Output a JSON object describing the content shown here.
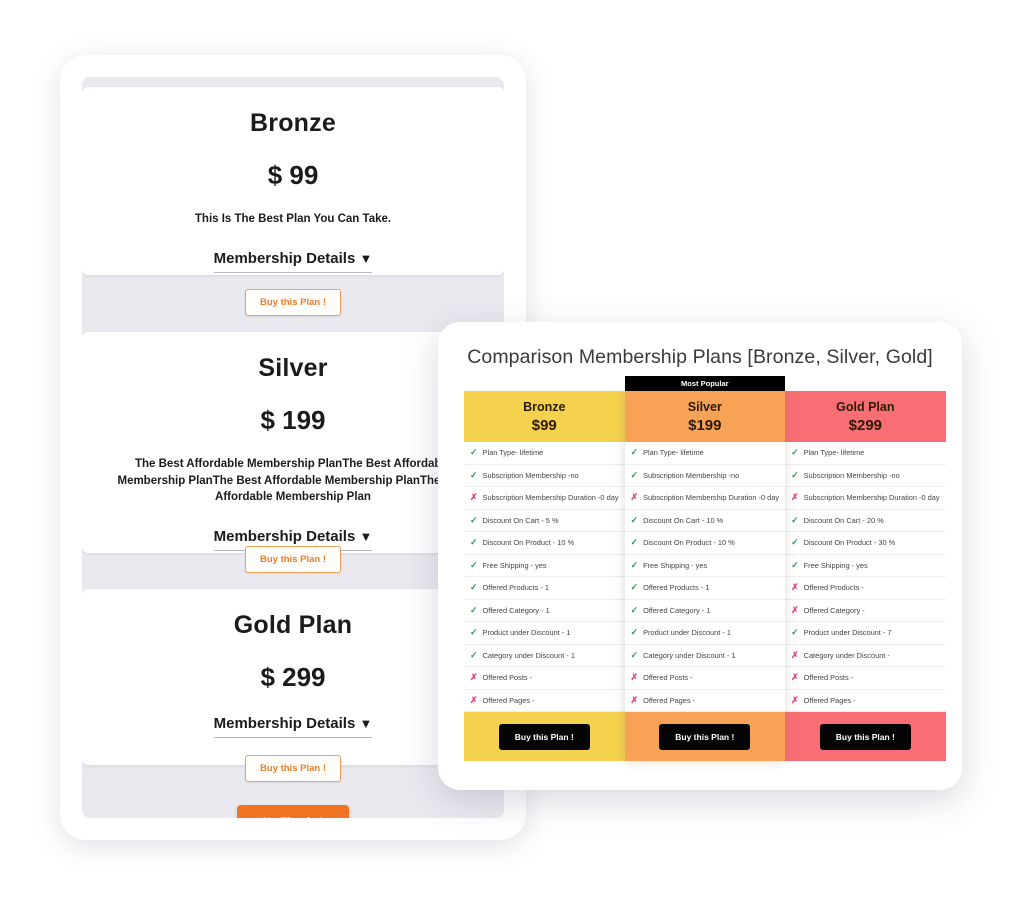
{
  "plans_panel": {
    "cards": [
      {
        "title": "Bronze",
        "price": "$ 99",
        "description": "This Is The Best Plan You Can Take.",
        "details_label": "Membership Details",
        "caret": "▼",
        "buy_label": "Buy this Plan !"
      },
      {
        "title": "Silver",
        "price": "$ 199",
        "description": "The Best Affordable Membership PlanThe Best Affordable Membership PlanThe Best Affordable Membership PlanThe Best Affordable Membership Plan",
        "details_label": "Membership Details",
        "caret": "▼",
        "buy_label": "Buy this Plan !"
      },
      {
        "title": "Gold Plan",
        "price": "$ 299",
        "description": "",
        "details_label": "Membership Details",
        "caret": "▼",
        "buy_label": "Buy this Plan !"
      }
    ],
    "no_thanks_label": "No Thanks!"
  },
  "comparison": {
    "title": "Comparison Membership Plans [Bronze, Silver, Gold]",
    "popular_badge": "Most Popular",
    "buy_label": "Buy this Plan !",
    "colors": {
      "bronze": "#F5D24D",
      "silver": "#F7A254",
      "gold": "#F96E74",
      "check": "#2E9B57",
      "cross": "#E8447D",
      "badge_bg": "#000000",
      "buy_bg": "#050505"
    },
    "columns": [
      {
        "name": "Bronze",
        "price": "$99",
        "popular": false,
        "features": [
          {
            "ok": true,
            "text": "Plan Type- lifetime"
          },
          {
            "ok": true,
            "text": "Subscription Membership -no"
          },
          {
            "ok": false,
            "text": "Subscription Membership Duration -0 day"
          },
          {
            "ok": true,
            "text": "Discount On Cart - 5 %"
          },
          {
            "ok": true,
            "text": "Discount On Product - 10 %"
          },
          {
            "ok": true,
            "text": "Free Shipping - yes"
          },
          {
            "ok": true,
            "text": "Offered Products - 1"
          },
          {
            "ok": true,
            "text": "Offered Category - 1"
          },
          {
            "ok": true,
            "text": "Product under Discount - 1"
          },
          {
            "ok": true,
            "text": "Category under Discount - 1"
          },
          {
            "ok": false,
            "text": "Offered Posts -"
          },
          {
            "ok": false,
            "text": "Offered Pages -"
          }
        ]
      },
      {
        "name": "Silver",
        "price": "$199",
        "popular": true,
        "features": [
          {
            "ok": true,
            "text": "Plan Type- lifetime"
          },
          {
            "ok": true,
            "text": "Subscription Membership -no"
          },
          {
            "ok": false,
            "text": "Subscription Membership Duration -0 day"
          },
          {
            "ok": true,
            "text": "Discount On Cart - 10 %"
          },
          {
            "ok": true,
            "text": "Discount On Product - 10 %"
          },
          {
            "ok": true,
            "text": "Free Shipping - yes"
          },
          {
            "ok": true,
            "text": "Offered Products - 1"
          },
          {
            "ok": true,
            "text": "Offered Category - 1"
          },
          {
            "ok": true,
            "text": "Product under Discount - 1"
          },
          {
            "ok": true,
            "text": "Category under Discount - 1"
          },
          {
            "ok": false,
            "text": "Offered Posts -"
          },
          {
            "ok": false,
            "text": "Offered Pages -"
          }
        ]
      },
      {
        "name": "Gold Plan",
        "price": "$299",
        "popular": false,
        "features": [
          {
            "ok": true,
            "text": "Plan Type- lifetime"
          },
          {
            "ok": true,
            "text": "Subscription Membership -no"
          },
          {
            "ok": false,
            "text": "Subscription Membership Duration -0 day"
          },
          {
            "ok": true,
            "text": "Discount On Cart - 20 %"
          },
          {
            "ok": true,
            "text": "Discount On Product - 30 %"
          },
          {
            "ok": true,
            "text": "Free Shipping - yes"
          },
          {
            "ok": false,
            "text": "Offered Products -"
          },
          {
            "ok": false,
            "text": "Offered Category -"
          },
          {
            "ok": true,
            "text": "Product under Discount - 7"
          },
          {
            "ok": false,
            "text": "Category under Discount -"
          },
          {
            "ok": false,
            "text": "Offered Posts -"
          },
          {
            "ok": false,
            "text": "Offered Pages -"
          }
        ]
      }
    ],
    "icons": {
      "check": "✓",
      "cross": "✗"
    }
  }
}
